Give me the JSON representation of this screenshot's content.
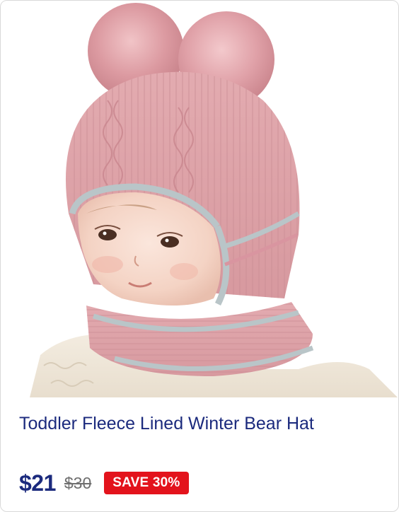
{
  "product": {
    "image_subject": "toddler-knit-balaclava-photo",
    "title": "Toddler Fleece Lined Winter Bear Hat",
    "price": "$21",
    "original_price": "$30",
    "badge": "SAVE 30%"
  },
  "colors": {
    "title": "#1b2a7d",
    "price": "#1b2a7d",
    "old_price": "#6f6f6f",
    "badge_bg": "#e3131c",
    "hat_pink": "#dfa4aa",
    "stripe_grey": "#b9c5c8"
  }
}
